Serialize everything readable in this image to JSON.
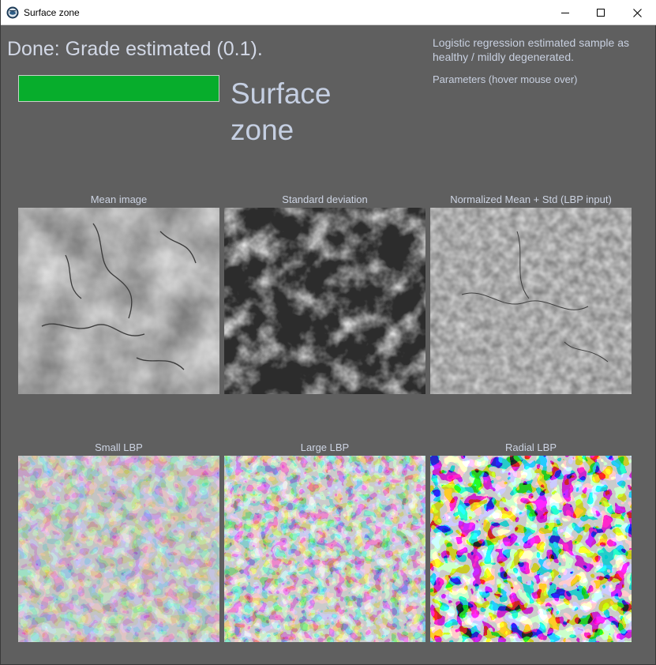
{
  "window": {
    "title": "Surface zone",
    "icons": {
      "app": "app-icon",
      "minimize": "minimize-icon",
      "maximize": "maximize-icon",
      "close": "close-icon"
    }
  },
  "status": {
    "message": "Done: Grade estimated (0.1).",
    "grade_color": "#07ad2c",
    "zone_title": "Surface zone"
  },
  "info": {
    "result_text": "Logistic regression estimated sample as healthy / mildly degenerated.",
    "parameters_text": "Parameters (hover mouse over)"
  },
  "panels": [
    {
      "label": "Mean image"
    },
    {
      "label": "Standard deviation"
    },
    {
      "label": "Normalized Mean + Std (LBP input)"
    },
    {
      "label": "Small LBP"
    },
    {
      "label": "Large LBP"
    },
    {
      "label": "Radial LBP"
    }
  ]
}
